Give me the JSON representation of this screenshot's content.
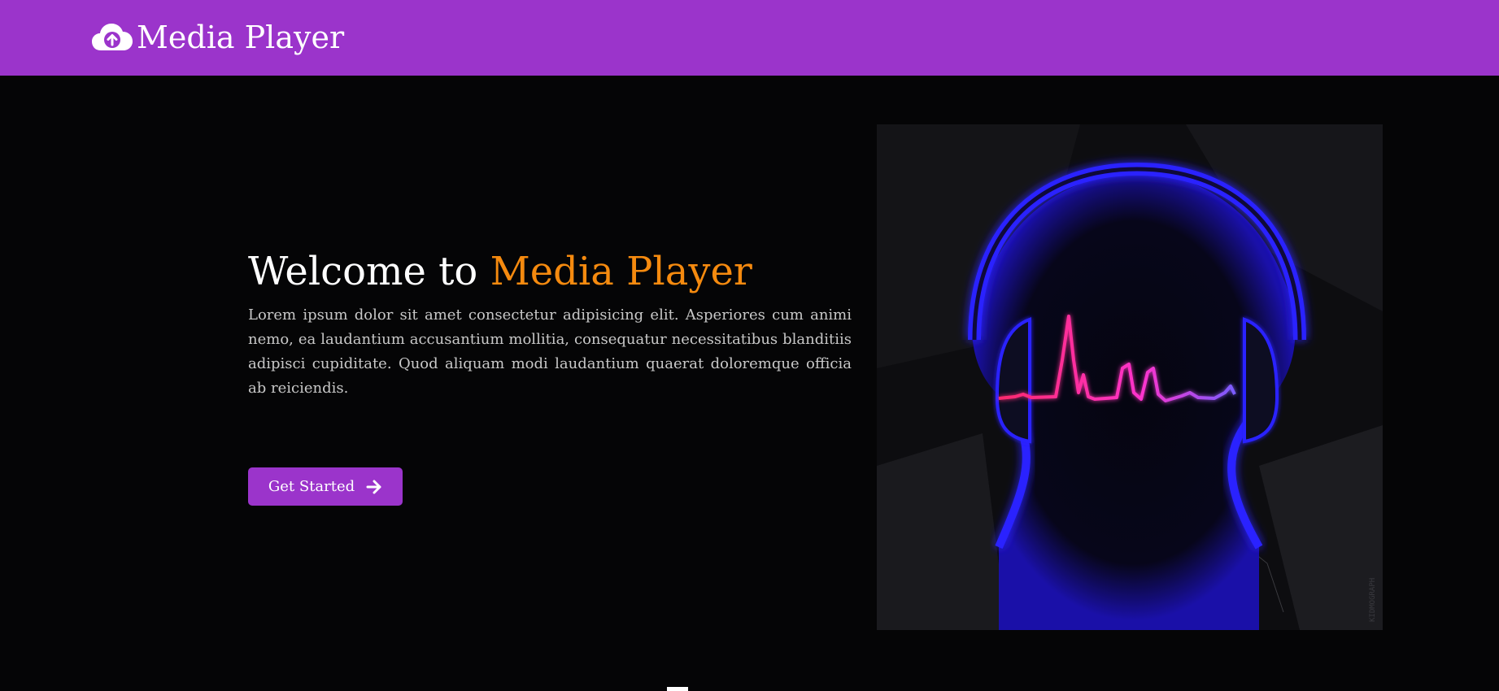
{
  "header": {
    "logo_icon": "cloud-upload-icon",
    "title": "Media Player"
  },
  "hero": {
    "title_prefix": "Welcome to",
    "title_highlight": "Media Player",
    "description": "Lorem ipsum dolor sit amet consectetur adipisicing elit. Asperiores cum animi nemo, ea laudantium accusantium mollitia, consequatur necessitatibus blanditiis adipisci cupiditate. Quod aliquam modi laudantium quaerat doloremque officia ab reiciendis.",
    "cta_label": "Get Started",
    "cta_icon": "arrow-right-icon",
    "image_watermark": "KIDMOGRAPH"
  },
  "colors": {
    "brand": "#9b34cb",
    "accent": "#f58a0f",
    "background": "#050506",
    "text": "#ffffff",
    "muted_text": "#c8c8c8"
  }
}
